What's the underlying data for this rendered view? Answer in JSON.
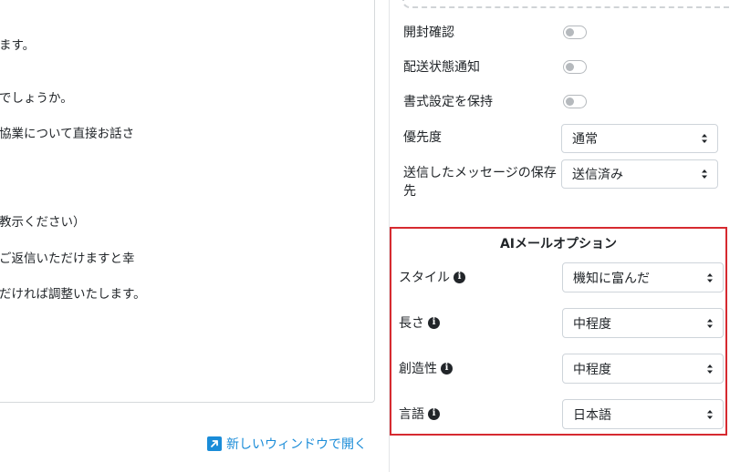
{
  "email_body": {
    "lines": [
      "ます。",
      "でしょうか。",
      "協業について直接お話さ",
      "教示ください）",
      "ご返信いただけますと幸",
      "だければ調整いたします。"
    ]
  },
  "open_new_window": {
    "label": "新しいウィンドウで開く",
    "icon": "external-link-icon"
  },
  "options": {
    "read_receipt": {
      "label": "開封確認",
      "enabled": false
    },
    "delivery_status": {
      "label": "配送状態通知",
      "enabled": false
    },
    "keep_formatting": {
      "label": "書式設定を保持",
      "enabled": false
    },
    "priority": {
      "label": "優先度",
      "value": "通常"
    },
    "sent_folder": {
      "label": "送信したメッセージの保存先",
      "value": "送信済み"
    }
  },
  "ai_options": {
    "title": "AIメールオプション",
    "style": {
      "label": "スタイル",
      "value": "機知に富んだ"
    },
    "length": {
      "label": "長さ",
      "value": "中程度"
    },
    "creativity": {
      "label": "創造性",
      "value": "中程度"
    },
    "language": {
      "label": "言語",
      "value": "日本語"
    }
  },
  "colors": {
    "accent_link": "#1a8cd8",
    "highlight_border": "#d62a30"
  }
}
